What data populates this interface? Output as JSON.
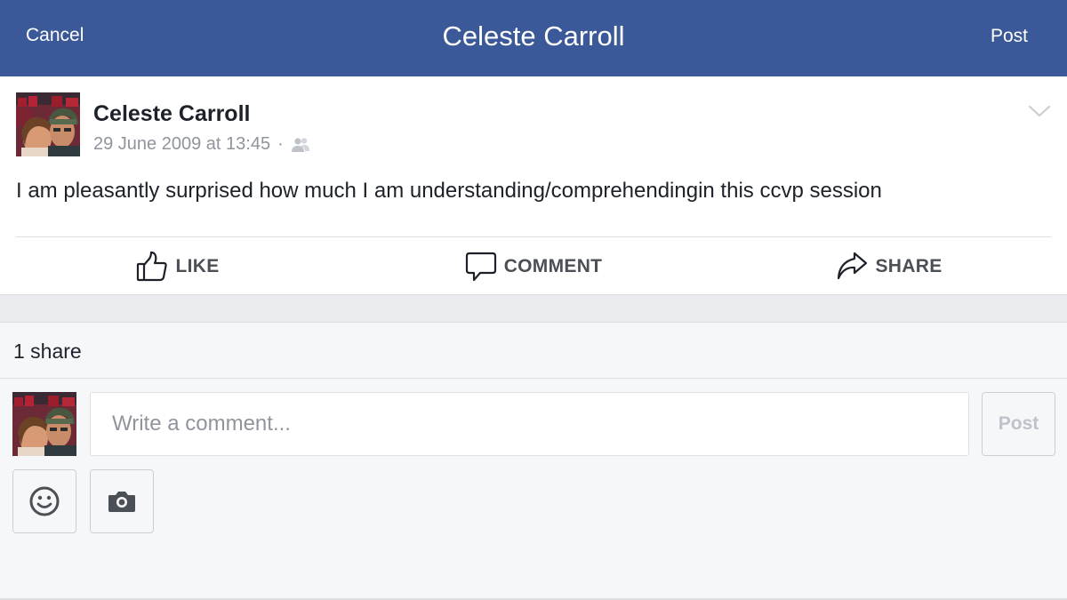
{
  "header": {
    "cancel_label": "Cancel",
    "title": "Celeste Carroll",
    "post_label": "Post"
  },
  "post": {
    "author": "Celeste Carroll",
    "timestamp": "29 June 2009 at 13:45",
    "separator": "·",
    "audience_icon": "friends-icon",
    "text": "I am pleasantly surprised how much I am understanding/comprehendingin this ccvp session",
    "actions": {
      "like_label": "LIKE",
      "comment_label": "COMMENT",
      "share_label": "SHARE"
    }
  },
  "engagement": {
    "share_count": "1 share"
  },
  "composer": {
    "placeholder": "Write a comment...",
    "post_label": "Post",
    "attachments": [
      "emoji-icon",
      "camera-icon"
    ]
  },
  "colors": {
    "nav_bar": "#3b5998",
    "page_background": "#f6f7f9",
    "text_primary": "#1d2129",
    "text_secondary": "#90949c",
    "action_text": "#4b4f56"
  }
}
